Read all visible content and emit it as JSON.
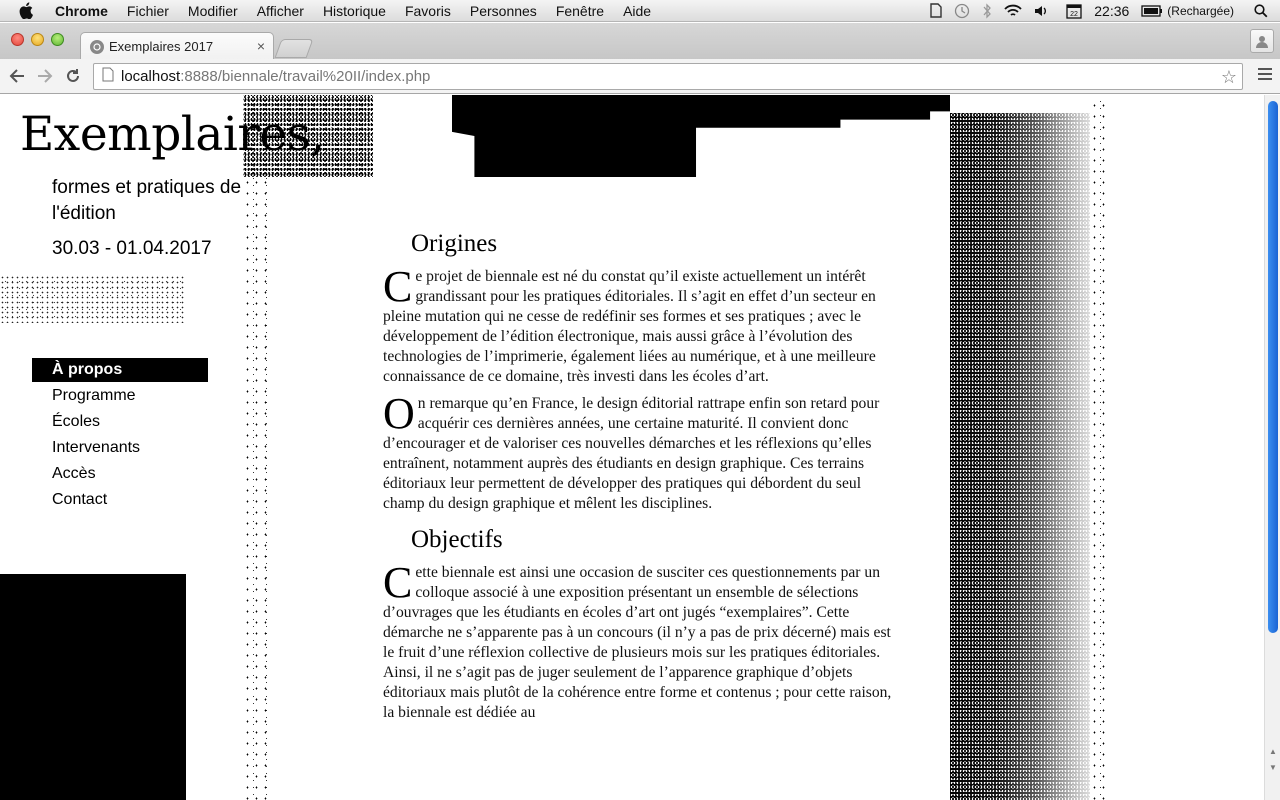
{
  "menubar": {
    "app_name": "Chrome",
    "items": [
      "Fichier",
      "Modifier",
      "Afficher",
      "Historique",
      "Favoris",
      "Personnes",
      "Fenêtre",
      "Aide"
    ],
    "clock": "22:36",
    "battery_status": "(Rechargée)"
  },
  "browser": {
    "tab_title": "Exemplaires 2017",
    "url_host": "localhost",
    "url_rest": ":8888/biennale/travail%20II/index.php"
  },
  "site": {
    "title": "Exemplaires,",
    "subtitle": "formes et pratiques de l'édition",
    "dates": "30.03 - 01.04.2017",
    "nav": [
      {
        "label": "À propos",
        "active": true
      },
      {
        "label": "Programme",
        "active": false
      },
      {
        "label": "Écoles",
        "active": false
      },
      {
        "label": "Intervenants",
        "active": false
      },
      {
        "label": "Accès",
        "active": false
      },
      {
        "label": "Contact",
        "active": false
      }
    ]
  },
  "article": {
    "sections": [
      {
        "heading": "Origines",
        "paragraphs": [
          {
            "dropcap": "C",
            "text": "e projet de biennale est né du constat qu’il existe actuellement un intérêt grandissant pour les pratiques éditoriales. Il s’agit en effet d’un secteur en pleine mutation qui ne cesse de redéfinir ses formes et ses pratiques ; avec le développement de l’édition électronique, mais aussi grâce à l’évolution des technologies de l’imprimerie, également liées au numérique, et à une meilleure connaissance de ce domaine, très investi dans les écoles d’art."
          },
          {
            "dropcap": "O",
            "text": "n remarque qu’en France, le design éditorial rattrape enfin son retard pour acquérir ces dernières années, une certaine maturité. Il convient donc d’encourager et de valoriser ces nouvelles démarches et les réflexions qu’elles entraînent, notamment auprès des étudiants en design graphique. Ces terrains éditoriaux leur permettent de développer des pratiques qui débordent du seul champ du design graphique et mêlent les disciplines."
          }
        ]
      },
      {
        "heading": "Objectifs",
        "paragraphs": [
          {
            "dropcap": "C",
            "text": "ette biennale est ainsi une occasion de susciter ces questionnements par un colloque associé à une exposition présentant un ensemble de sélections d’ouvrages que les étudiants en écoles d’art ont jugés “exemplaires”. Cette démarche ne s’apparente pas à un concours (il n’y a pas de prix décerné) mais est le fruit d’une réflexion collective de plusieurs mois sur les pratiques éditoriales. Ainsi, il ne s’agit pas de juger seulement de l’apparence graphique d’objets éditoriaux mais plutôt de la cohérence entre forme et contenus ; pour cette raison, la biennale est dédiée au"
          }
        ]
      }
    ]
  }
}
